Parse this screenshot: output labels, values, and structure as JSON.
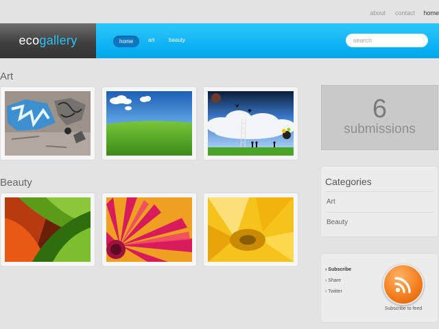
{
  "top_links": [
    {
      "label": "about",
      "active": false
    },
    {
      "label": "contact",
      "active": false
    },
    {
      "label": "home",
      "active": true
    }
  ],
  "logo": {
    "part1": "eco",
    "part2": "gallery"
  },
  "nav": [
    {
      "label": "home",
      "active": true
    },
    {
      "label": "art",
      "active": false
    },
    {
      "label": "beauty",
      "active": false
    }
  ],
  "search": {
    "placeholder": "search"
  },
  "sections": [
    {
      "title": "Art",
      "thumbnails": [
        "graffiti-wall",
        "green-field-sky",
        "surreal-clouds-ladder"
      ]
    },
    {
      "title": "Beauty",
      "thumbnails": [
        "green-leaf-macro",
        "pink-flower",
        "yellow-flower"
      ]
    }
  ],
  "stats": {
    "count": "6",
    "label": "submissions"
  },
  "categories": {
    "title": "Categories",
    "items": [
      "Art",
      "Beauty"
    ]
  },
  "subscribe": {
    "links": [
      "Subscribe",
      "Share",
      "Twitter"
    ],
    "feed_label": "Subscribe to feed"
  },
  "colors": {
    "accent": "#00b4f5",
    "nav_active": "#0c78c4",
    "rss": "#f57f1e"
  }
}
